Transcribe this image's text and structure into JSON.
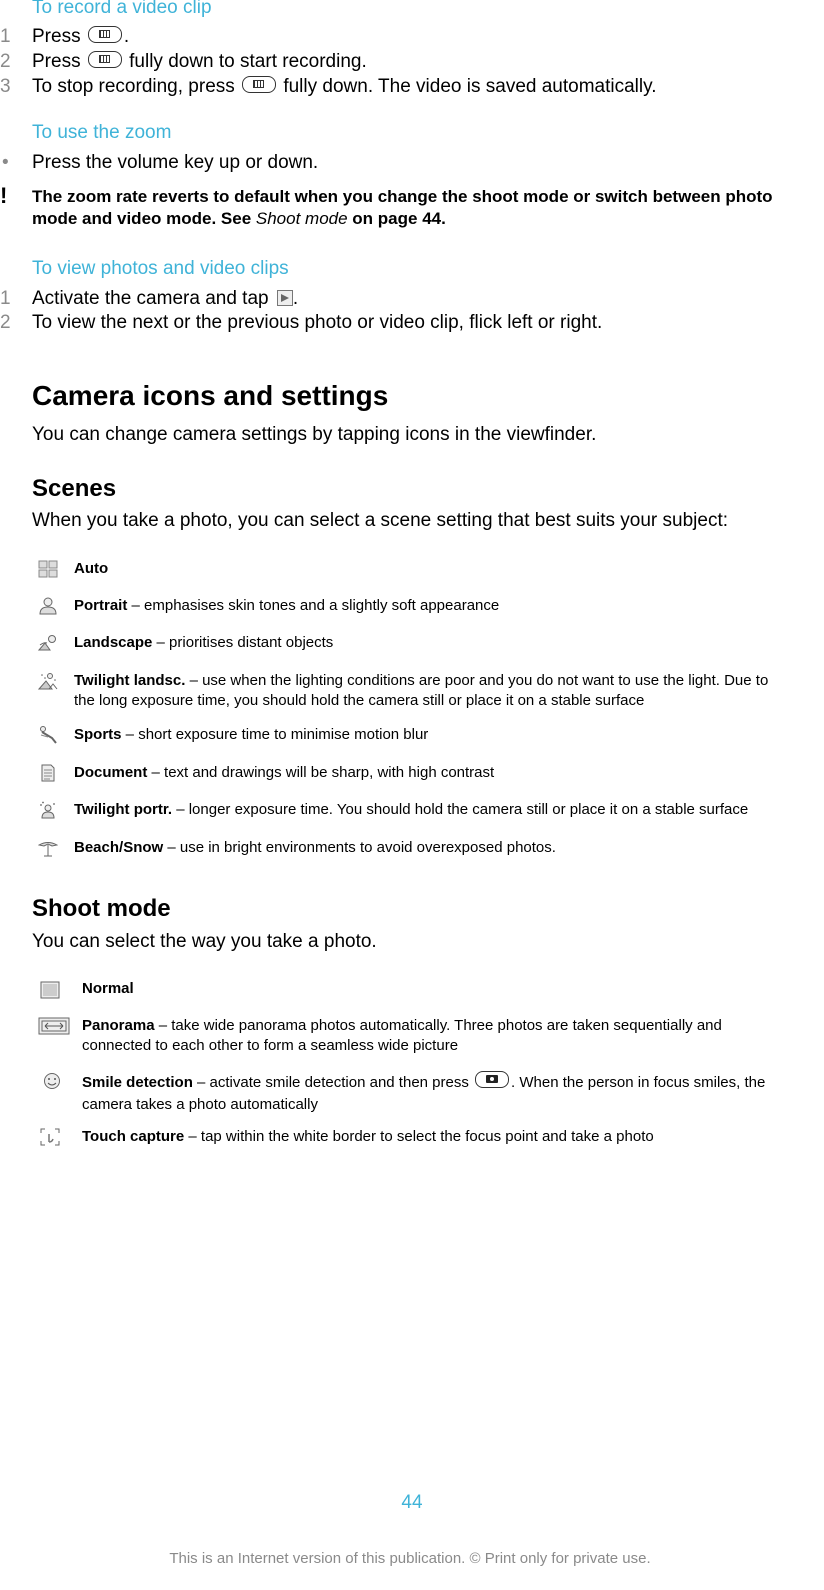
{
  "record_video": {
    "title": "To record a video clip",
    "steps": [
      {
        "num": "1",
        "before": "Press ",
        "icon": "video-key-icon",
        "after": "."
      },
      {
        "num": "2",
        "before": "Press ",
        "icon": "video-key-icon",
        "after": " fully down to start recording."
      },
      {
        "num": "3",
        "before": "To stop recording, press ",
        "icon": "video-key-icon",
        "after": " fully down. The video is saved automatically."
      }
    ]
  },
  "use_zoom": {
    "title": "To use the zoom",
    "bullet": "Press the volume key up or down.",
    "bullet_marker": "•",
    "note_icon": "!",
    "note_line1": "The zoom rate reverts to default when you change the shoot mode or switch between photo",
    "note_line2_before": "mode and video mode. See ",
    "note_line2_link": "Shoot mode",
    "note_line2_after": " on page 44."
  },
  "view_photos": {
    "title": "To view photos and video clips",
    "steps": [
      {
        "num": "1",
        "before": "Activate the camera and tap ",
        "icon": "play-thumbnail-icon",
        "after": "."
      },
      {
        "num": "2",
        "text": "To view the next or the previous photo or video clip, flick left or right."
      }
    ]
  },
  "camera_icons": {
    "title": "Camera icons and settings",
    "intro": "You can change camera settings by tapping icons in the viewfinder."
  },
  "scenes": {
    "title": "Scenes",
    "intro": "When you take a photo, you can select a scene setting that best suits your subject:",
    "items": [
      {
        "icon": "auto-scene-icon",
        "name": "Auto",
        "desc": ""
      },
      {
        "icon": "portrait-scene-icon",
        "name": "Portrait",
        "desc": " – emphasises skin tones and a slightly soft appearance"
      },
      {
        "icon": "landscape-scene-icon",
        "name": "Landscape",
        "desc": " – prioritises distant objects"
      },
      {
        "icon": "twilight-landscape-icon",
        "name": "Twilight landsc.",
        "desc": " – use when the lighting conditions are poor and you do not want to use the light. Due to",
        "desc2": "the long exposure time, you should hold the camera still or place it on a stable surface"
      },
      {
        "icon": "sports-scene-icon",
        "name": "Sports",
        "desc": " – short exposure time to minimise motion blur"
      },
      {
        "icon": "document-scene-icon",
        "name": "Document",
        "desc": " – text and drawings will be sharp, with high contrast"
      },
      {
        "icon": "twilight-portrait-icon",
        "name": "Twilight portr.",
        "desc": " – longer exposure time. You should hold the camera still or place it on a stable surface"
      },
      {
        "icon": "beach-snow-icon",
        "name": "Beach/Snow",
        "desc": " – use in bright environments to avoid overexposed photos."
      }
    ]
  },
  "shoot_mode": {
    "title": "Shoot mode",
    "intro": "You can select the way you take a photo.",
    "items": [
      {
        "icon": "normal-mode-icon",
        "name": "Normal",
        "desc": ""
      },
      {
        "icon": "panorama-mode-icon",
        "name": "Panorama",
        "desc": " – take wide panorama photos automatically. Three photos are taken sequentially and",
        "desc2": "connected to each other to form a seamless wide picture"
      },
      {
        "icon": "smile-detection-icon",
        "name": "Smile detection",
        "desc": " – activate smile detection and then press ",
        "desc_after_icon": ". When the person in focus smiles, the",
        "desc2": "camera takes a photo automatically"
      },
      {
        "icon": "touch-capture-icon",
        "name": "Touch capture",
        "desc": " – tap within the white border to select the focus point and take a photo"
      }
    ]
  },
  "footer": {
    "page_number": "44",
    "notice": "This is an Internet version of this publication. © Print only for private use."
  },
  "colors": {
    "accent": "#3fb3d8",
    "step_number": "#8a8a8a",
    "text": "#000000"
  }
}
